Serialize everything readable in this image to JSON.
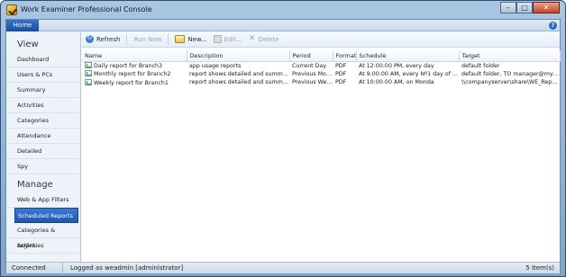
{
  "window": {
    "title": "Work Examiner Professional Console",
    "controls": [
      "–",
      "□",
      "✕"
    ]
  },
  "ribbon": {
    "home_tab": "Home",
    "help": "?"
  },
  "sidebar": {
    "view_header": "View",
    "view_items": [
      "Dashboard",
      "Users & PCs",
      "Summary",
      "Activities",
      "Categories",
      "Attendance",
      "Detailed",
      "Spy"
    ],
    "manage_header": "Manage",
    "manage_items": [
      "Web & App Filters",
      "Scheduled Reports",
      "Categories & Activities",
      "Logins"
    ],
    "active_item": "Scheduled Reports"
  },
  "toolbar": {
    "refresh": "Refresh",
    "run_now": "Run Now",
    "new": "New...",
    "edit": "Edit...",
    "delete": "Delete"
  },
  "grid": {
    "columns": [
      "Name",
      "Description",
      "Period",
      "Format",
      "Schedule",
      "Target"
    ],
    "rows": [
      [
        "Daily report for Branch3",
        "app usage reports",
        "Current Day",
        "PDF",
        "At 12:00:00 PM, every day",
        "default folder"
      ],
      [
        "Monthly report for Branch2",
        "report shows detailed and summariz...",
        "Previous Month",
        "PDF",
        "At 9:00:00 AM, every Nº1 day of m...",
        "default folder, TO manager@mycom..."
      ],
      [
        "Weekly report for Branch1",
        "report shows detailed and summariz...",
        "Previous Week",
        "PDF",
        "At 10:00:00 AM, on Monda",
        "\\\\companyserver\\share\\WE_Reports..."
      ]
    ]
  },
  "status": {
    "connection": "Connected",
    "user": "Logged as weadmin [administrator]",
    "items": "5 Item(s)"
  },
  "colors": {
    "accent": "#1f57b0",
    "frame": "#7fa4c8"
  }
}
